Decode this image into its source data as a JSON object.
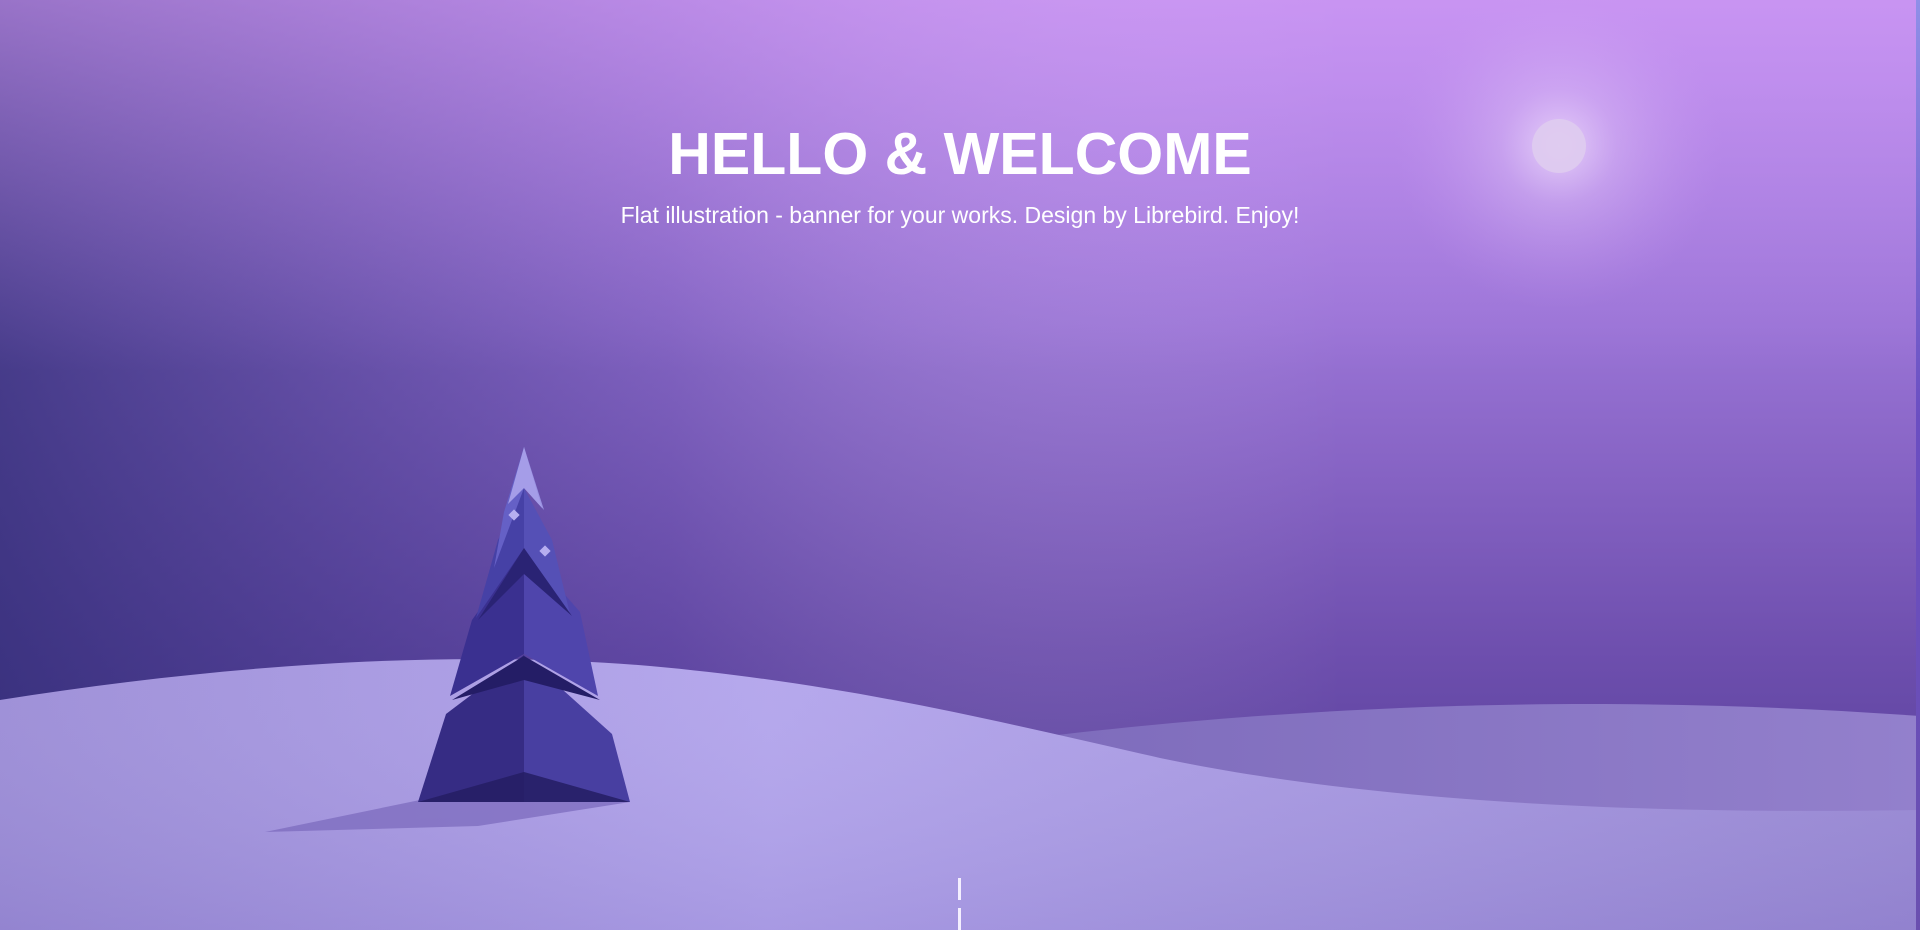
{
  "banner": {
    "title": "HELLO & WELCOME",
    "subtitle": "Flat illustration - banner for your works. Design by Librebird. Enjoy!"
  },
  "colors": {
    "sky_top": "#c08bf0",
    "sky_mid": "#8b63c5",
    "sky_bottom": "#4f3a8f",
    "sky_left_dark": "#2e2a6e",
    "snow_front": "#aa9be3",
    "snow_back": "#8b7bc6",
    "tree_light": "#4f48a8",
    "tree_dark": "#2f2a80",
    "moon": "#e0cfee",
    "text": "#ffffff"
  },
  "icons": {
    "moon": "moon-icon",
    "tree": "pine-tree-icon"
  }
}
